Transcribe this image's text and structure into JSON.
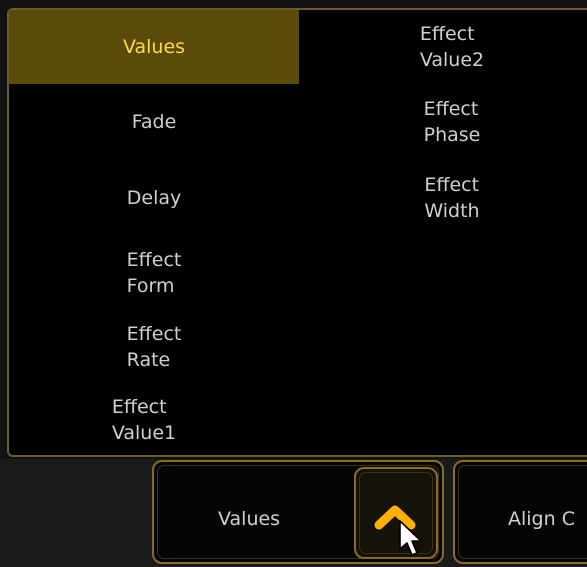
{
  "layers_panel": {
    "left_column": [
      {
        "label": "Values",
        "active": true
      },
      {
        "label": "Fade",
        "active": false
      },
      {
        "label": "Delay",
        "active": false
      },
      {
        "label": "Effect\nForm",
        "active": false
      },
      {
        "label": "Effect\nRate",
        "active": false
      },
      {
        "label": "Effect\nValue1",
        "active": false
      }
    ],
    "right_column": [
      {
        "label": "Effect\nValue2",
        "active": false
      },
      {
        "label": "Effect\nPhase",
        "active": false
      },
      {
        "label": "Effect\nWidth",
        "active": false
      }
    ]
  },
  "toolbar": {
    "values_label": "Values",
    "scroll_up_icon": "chevron-up-icon",
    "align_label": "Align C"
  },
  "colors": {
    "accent": "#ffb000",
    "active_bg": "#5a4b08",
    "active_text": "#ffd84a",
    "border": "#8a6d1e"
  }
}
